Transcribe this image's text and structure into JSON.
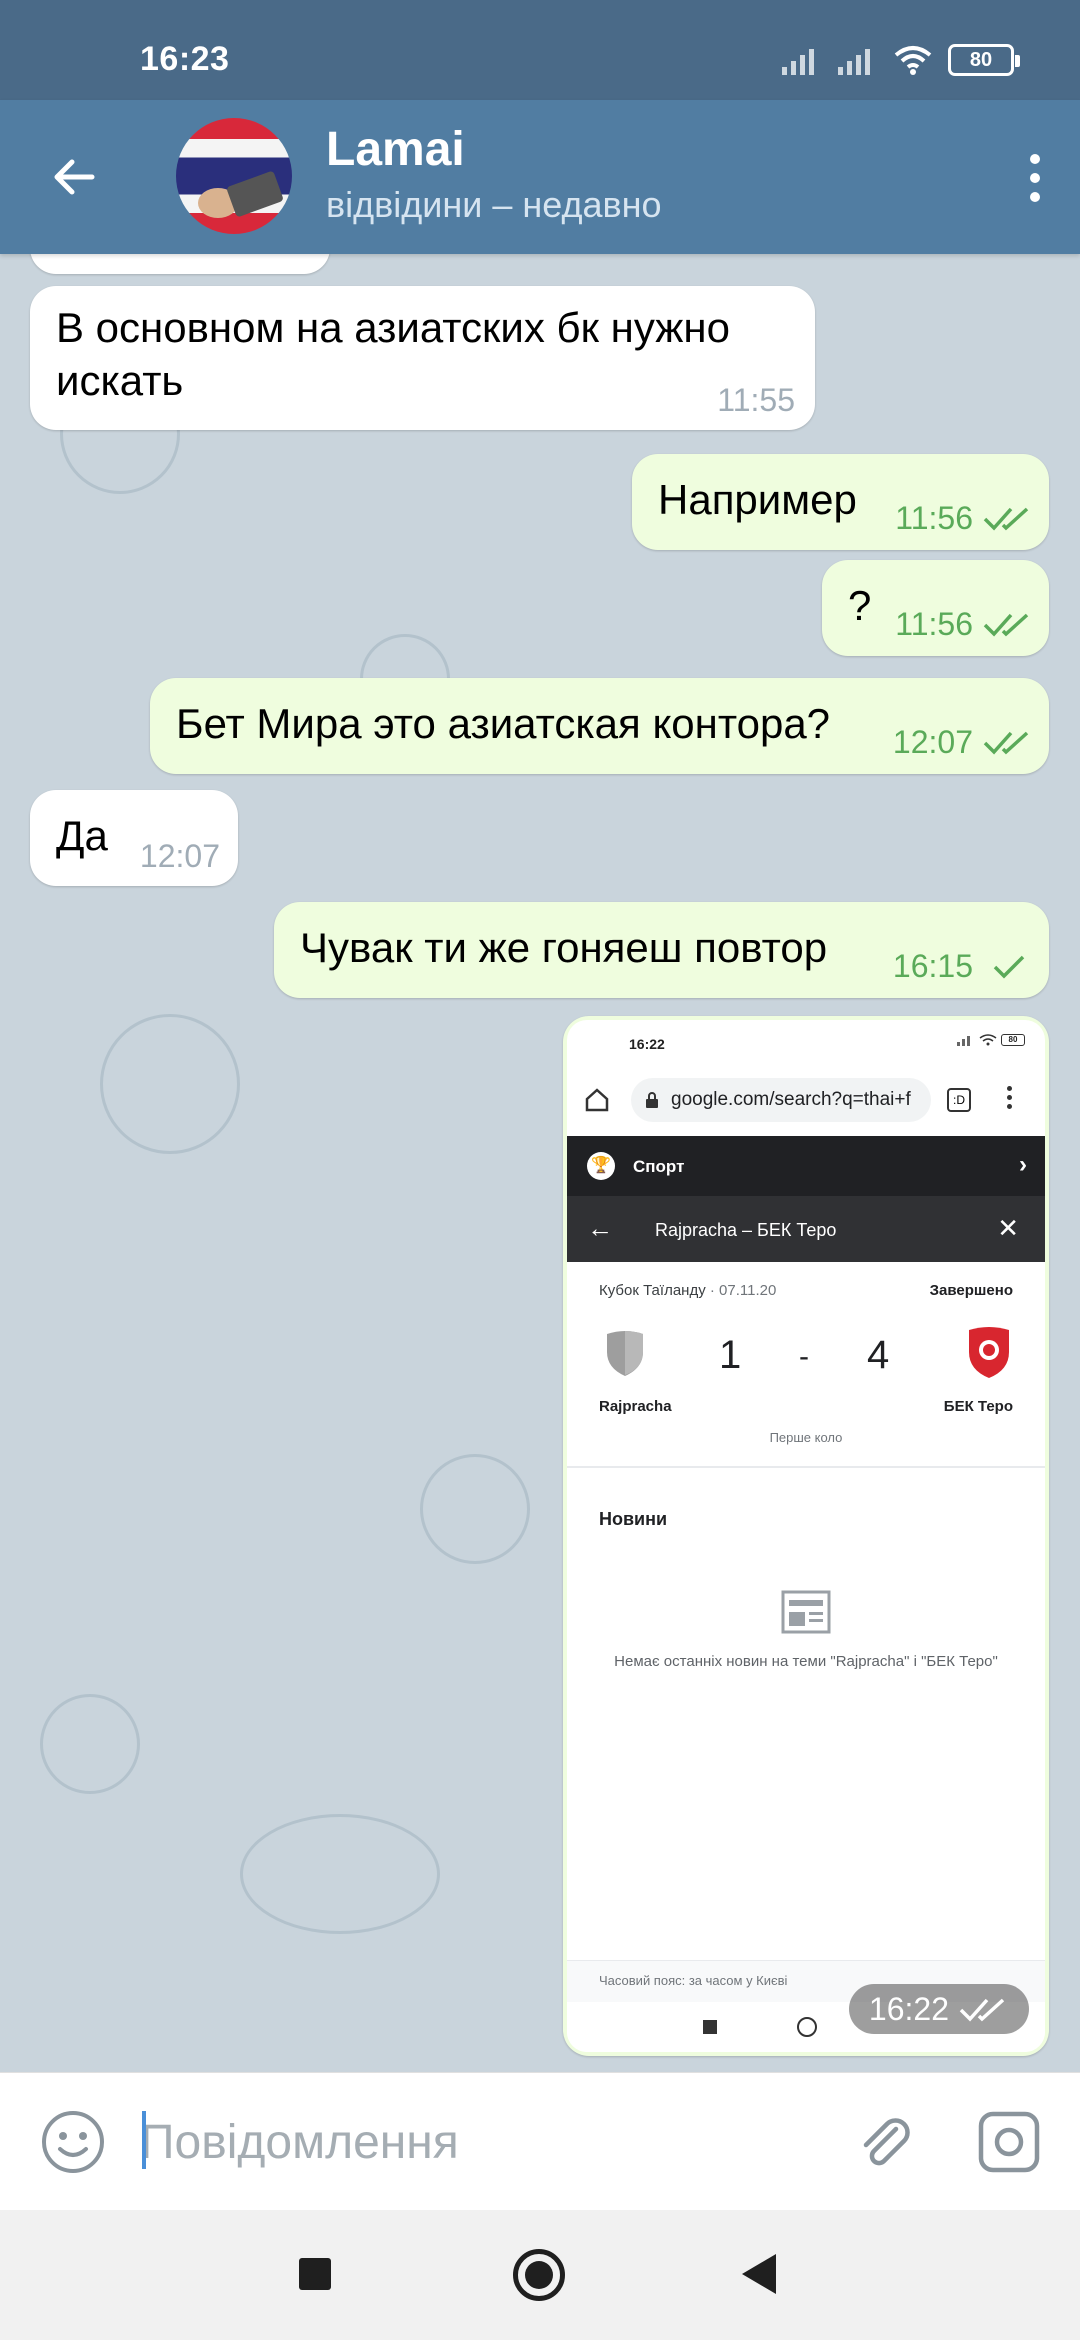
{
  "status_bar": {
    "time": "16:23",
    "battery": "80"
  },
  "header": {
    "name": "Lamai",
    "status": "відвідини – недавно"
  },
  "messages": [
    {
      "dir": "in",
      "text": "В основном на азиатских бк нужно искать",
      "time": "11:55"
    },
    {
      "dir": "out",
      "text": "Например",
      "time": "11:56",
      "status": "read"
    },
    {
      "dir": "out",
      "text": "?",
      "time": "11:56",
      "status": "read"
    },
    {
      "dir": "out",
      "text": "Бет Мира это азиатская контора?",
      "time": "12:07",
      "status": "read"
    },
    {
      "dir": "in",
      "text": "Да",
      "time": "12:07"
    },
    {
      "dir": "out",
      "text": "Чувак ти же гоняеш повтор",
      "time": "16:15",
      "status": "sent"
    }
  ],
  "photo_message": {
    "time": "16:22",
    "status": "read",
    "screenshot": {
      "status_time": "16:22",
      "battery": "80",
      "url": "google.com/search?q=thai+f",
      "tab_count": ":D",
      "section": "Спорт",
      "match_title": "Rajpracha – БЕК Теро",
      "competition": "Кубок Таїланду",
      "date": "· 07.11.20",
      "state": "Завершено",
      "home_team": "Rajpracha",
      "away_team": "БЕК Теро",
      "home_score": "1",
      "separator": "-",
      "away_score": "4",
      "round": "Перше коло",
      "news_title": "Новини",
      "news_empty": "Немає останніх новин на теми \"Rajpracha\" і \"БЕК Теро\"",
      "timezone": "Часовий пояс: за часом у Києві"
    }
  },
  "input": {
    "placeholder": "Повідомлення"
  },
  "colors": {
    "header": "#517da2",
    "status_bar": "#4a6a88",
    "outgoing": "#effdde",
    "incoming": "#ffffff",
    "check": "#5aaa59"
  }
}
